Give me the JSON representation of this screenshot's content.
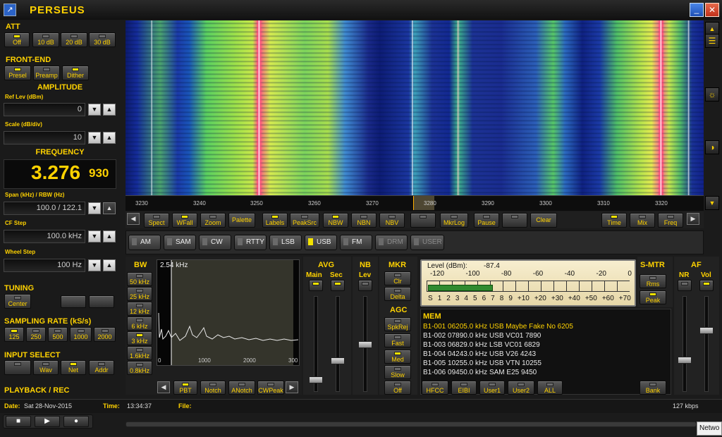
{
  "app": {
    "title": "PERSEUS"
  },
  "att": {
    "title": "ATT",
    "buttons": [
      {
        "label": "Off",
        "on": true
      },
      {
        "label": "10 dB",
        "on": false
      },
      {
        "label": "20 dB",
        "on": false
      },
      {
        "label": "30 dB",
        "on": false
      }
    ]
  },
  "frontend": {
    "title": "FRONT-END",
    "buttons": [
      {
        "label": "Presel",
        "on": true
      },
      {
        "label": "Preamp",
        "on": false
      },
      {
        "label": "Dither",
        "on": true
      }
    ]
  },
  "amplitude": {
    "title": "AMPLITUDE",
    "ref_label": "Ref Lev (dBm)",
    "ref_value": "0",
    "scale_label": "Scale (dB/div)",
    "scale_value": "10"
  },
  "frequency": {
    "title": "FREQUENCY",
    "main": "3.276",
    "fine": "930",
    "span_label": "Span (kHz) / RBW (Hz)",
    "span_value": "100.0 / 122.1",
    "cf_label": "CF Step",
    "cf_value": "100.0 kHz",
    "wheel_label": "Wheel Step",
    "wheel_value": "100 Hz"
  },
  "tuning": {
    "title": "TUNING",
    "center": "Center"
  },
  "sampling": {
    "title": "SAMPLING RATE (kS/s)",
    "rates": [
      {
        "label": "125",
        "on": true
      },
      {
        "label": "250",
        "on": false
      },
      {
        "label": "500",
        "on": false
      },
      {
        "label": "1000",
        "on": false
      },
      {
        "label": "2000",
        "on": false
      }
    ]
  },
  "input": {
    "title": "INPUT SELECT",
    "buttons": [
      {
        "label": "Wav",
        "on": false
      },
      {
        "label": "Net",
        "on": true
      },
      {
        "label": "Addr",
        "on": false
      }
    ]
  },
  "playback": {
    "title": "PLAYBACK / REC"
  },
  "status": {
    "date_label": "Date:",
    "date": "Sat 28-Nov-2015",
    "time_label": "Time:",
    "time": "13:34:37",
    "file_label": "File:",
    "rate": "127 kbps"
  },
  "axis": {
    "ticks": [
      "3230",
      "3240",
      "3250",
      "3260",
      "3270",
      "3280",
      "3290",
      "3300",
      "3310",
      "3320"
    ]
  },
  "toolbar": [
    {
      "label": "Spect",
      "on": false
    },
    {
      "label": "WFall",
      "on": true
    },
    {
      "label": "Zoom",
      "on": false
    },
    {
      "label": "Palette",
      "on": false
    },
    {
      "label": "Labels",
      "on": true
    },
    {
      "label": "PeakSrc",
      "on": false
    },
    {
      "label": "NBW",
      "on": true
    },
    {
      "label": "NBN",
      "on": false
    },
    {
      "label": "NBV",
      "on": false
    },
    {
      "label": "MkrLog",
      "on": false
    },
    {
      "label": "Pause",
      "on": false
    },
    {
      "label": "Clear",
      "on": false
    },
    {
      "label": "Time",
      "on": true
    },
    {
      "label": "Mix",
      "on": false
    },
    {
      "label": "Freq",
      "on": false
    }
  ],
  "modes": [
    {
      "label": "AM",
      "on": false,
      "dim": false
    },
    {
      "label": "SAM",
      "on": false,
      "dim": false
    },
    {
      "label": "CW",
      "on": false,
      "dim": false
    },
    {
      "label": "RTTY",
      "on": false,
      "dim": false
    },
    {
      "label": "LSB",
      "on": false,
      "dim": false
    },
    {
      "label": "USB",
      "on": true,
      "dim": false
    },
    {
      "label": "FM",
      "on": false,
      "dim": false
    },
    {
      "label": "DRM",
      "on": false,
      "dim": true
    },
    {
      "label": "USER",
      "on": false,
      "dim": true
    }
  ],
  "bw": {
    "title": "BW",
    "value": "2.54 kHz",
    "buttons": [
      "50 kHz",
      "25 kHz",
      "12 kHz",
      "6 kHz",
      "3 kHz",
      "1.6kHz",
      "0.8kHz"
    ],
    "ticks": [
      "0",
      "1000",
      "2000",
      "300"
    ]
  },
  "filter_buttons": [
    "PBT",
    "Notch",
    "ANotch",
    "CWPeak"
  ],
  "avg": {
    "title": "AVG",
    "main": "Main",
    "sec": "Sec"
  },
  "nb": {
    "title": "NB",
    "lev": "Lev"
  },
  "mkr": {
    "title": "MKR",
    "clr": "Clr",
    "delta": "Delta"
  },
  "agc": {
    "title": "AGC",
    "buttons": [
      "SpkRej",
      "Fast",
      "Med",
      "Slow",
      "Off"
    ]
  },
  "level": {
    "label": "Level (dBm):",
    "value": "-87.4",
    "top_scale": [
      "-120",
      "-100",
      "-80",
      "-60",
      "-40",
      "-20",
      "0"
    ],
    "bottom_scale": [
      "S",
      "1",
      "2",
      "3",
      "4",
      "5",
      "6",
      "7",
      "8",
      "9",
      "+10",
      "+20",
      "+30",
      "+40",
      "+50",
      "+60",
      "+70"
    ],
    "bar_fraction": 0.32
  },
  "smtr": {
    "title": "S-MTR",
    "rms": "Rms",
    "peak": "Peak"
  },
  "af": {
    "title": "AF",
    "nr": "NR",
    "vol": "Vol"
  },
  "mem": {
    "title": "MEM",
    "rows": [
      "B1-001 06205.0 kHz USB  Maybe Fake No 6205",
      "B1-002 07890.0 kHz USB  VC01 7890",
      "B1-003 06829.0 kHz LSB  VC01 6829",
      "B1-004 04243.0 kHz USB  V26 4243",
      "B1-005 10255.0 kHz USB  VTN 10255",
      "B1-006 09450.0 kHz SAM  E25 9450"
    ],
    "buttons": [
      "HFCC",
      "EIBI",
      "User1",
      "User2",
      "ALL"
    ],
    "bank": "Bank"
  },
  "taskbar": {
    "label": "Netwo"
  },
  "colors": {
    "accent": "#ffd200",
    "led_on": "#f3e300",
    "bg": "#1b1b1b"
  }
}
